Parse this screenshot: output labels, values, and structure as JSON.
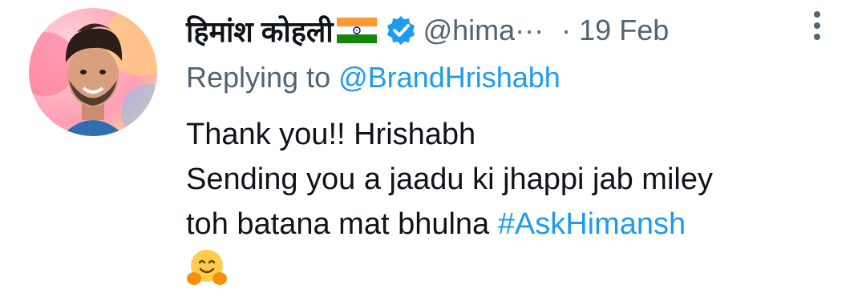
{
  "tweet": {
    "author": {
      "name": "हिमांश कोहली",
      "handle": "@hima···",
      "flag": "india-flag-icon",
      "verified": true
    },
    "dot": "·",
    "timestamp": "19 Feb",
    "replying": {
      "prefix": "Replying to ",
      "mention": "@BrandHrishabh"
    },
    "lines": {
      "line1": "Thank you!! Hrishabh",
      "line2": "Sending you a jaadu ki jhappi jab miley",
      "line3_text": "toh batana mat bhulna ",
      "hashtag": "#AskHimansh"
    },
    "emoji": "hugging-face-icon"
  },
  "colors": {
    "text": "#0f1419",
    "secondary": "#536471",
    "link": "#1d9bf0"
  }
}
